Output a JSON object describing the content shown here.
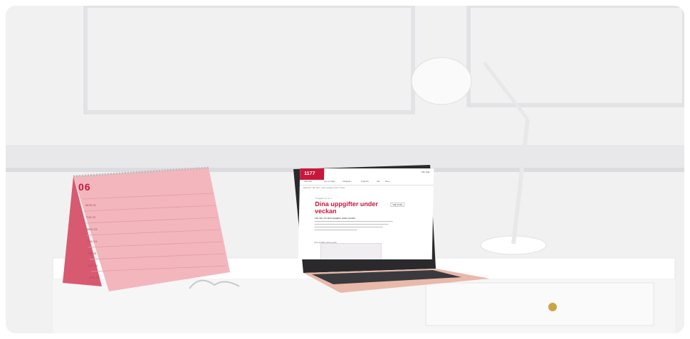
{
  "colors": {
    "accent": "#c8173b",
    "wall": "#f1f1f2",
    "calendar": "#f3b6bd",
    "laptop": "#e9b9aa"
  },
  "calendar": {
    "month": "06",
    "rows": [
      "MON 21",
      "TUE 22",
      "WED 23",
      "THU 24",
      "FRI 25",
      "SAT 26",
      "SUN 27"
    ]
  },
  "laptop": {
    "logo": "1177",
    "user": "Min sida",
    "nav": [
      "Hitta vård",
      "Läs om hälsa",
      "Vårdgivare",
      "E-tjänster",
      "Sök",
      "Meny"
    ],
    "breadcrumb": "Startsida > Min vård > Dina uppgifter under veckan",
    "kicker": "Inloggad via 1177",
    "title": "Dina uppgifter under veckan",
    "select": "Välj vecka",
    "lead": "Läs mer om dina uppgifter under veckan.",
    "tasks_label": "Dina uppgifter denna vecka"
  }
}
